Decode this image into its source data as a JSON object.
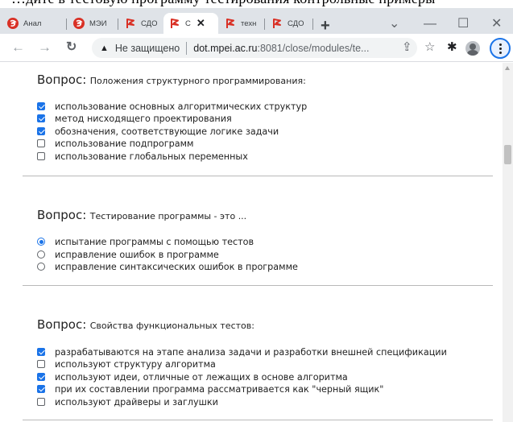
{
  "background_text": "…дите в тестовую программу тестирования контрольные примеры",
  "browser": {
    "tabs": [
      {
        "label": "Анал",
        "favicon": "mpei-logo-icon",
        "active": false
      },
      {
        "label": "МЭИ",
        "favicon": "mpei-logo-icon",
        "active": false
      },
      {
        "label": "СДО",
        "favicon": "sdo-flag-icon",
        "active": false
      },
      {
        "label": "С",
        "favicon": "sdo-flag-icon",
        "active": true
      },
      {
        "label": "техн",
        "favicon": "sdo-flag-icon",
        "active": false
      },
      {
        "label": "СДО",
        "favicon": "sdo-flag-icon",
        "active": false
      }
    ],
    "close_tab_glyph": "✕",
    "new_tab_glyph": "+",
    "window_controls": {
      "dropdown": "⌄",
      "minimize": "—",
      "maximize": "☐",
      "close": "✕"
    },
    "address": {
      "security_label": "Не защищено",
      "url_host": "dot.mpei.ac.ru",
      "url_rest": ":8081/close/modules/te..."
    },
    "colors": {
      "accent": "#1a73e8",
      "mpei_red": "#d93025",
      "tabbar": "#dfe3e8"
    }
  },
  "questions": [
    {
      "prefix": "Вопрос:",
      "text": "Положения структурного программирования:",
      "type": "checkbox",
      "options": [
        {
          "label": "использование основных алгоритмических структур",
          "checked": true
        },
        {
          "label": "метод нисходящего проектирования",
          "checked": true
        },
        {
          "label": "обозначения, соответствующие логике задачи",
          "checked": true
        },
        {
          "label": "использование подпрограмм",
          "checked": false
        },
        {
          "label": "использование глобальных переменных",
          "checked": false
        }
      ]
    },
    {
      "prefix": "Вопрос:",
      "text": "Тестирование программы - это ...",
      "type": "radio",
      "options": [
        {
          "label": "испытание программы с помощью тестов",
          "checked": true
        },
        {
          "label": "исправление ошибок в программе",
          "checked": false
        },
        {
          "label": "исправление синтаксических ошибок в программе",
          "checked": false
        }
      ]
    },
    {
      "prefix": "Вопрос:",
      "text": "Свойства функциональных тестов:",
      "type": "checkbox",
      "options": [
        {
          "label": "разрабатываются на этапе анализа задачи и разработки внешней спецификации",
          "checked": true
        },
        {
          "label": "используют структуру алгоритма",
          "checked": false
        },
        {
          "label": "используют идеи, отличные от лежащих в основе алгоритма",
          "checked": true
        },
        {
          "label": "при их составлении программа рассматривается как \"черный ящик\"",
          "checked": true
        },
        {
          "label": "используют драйверы и заглушки",
          "checked": false
        }
      ]
    }
  ]
}
